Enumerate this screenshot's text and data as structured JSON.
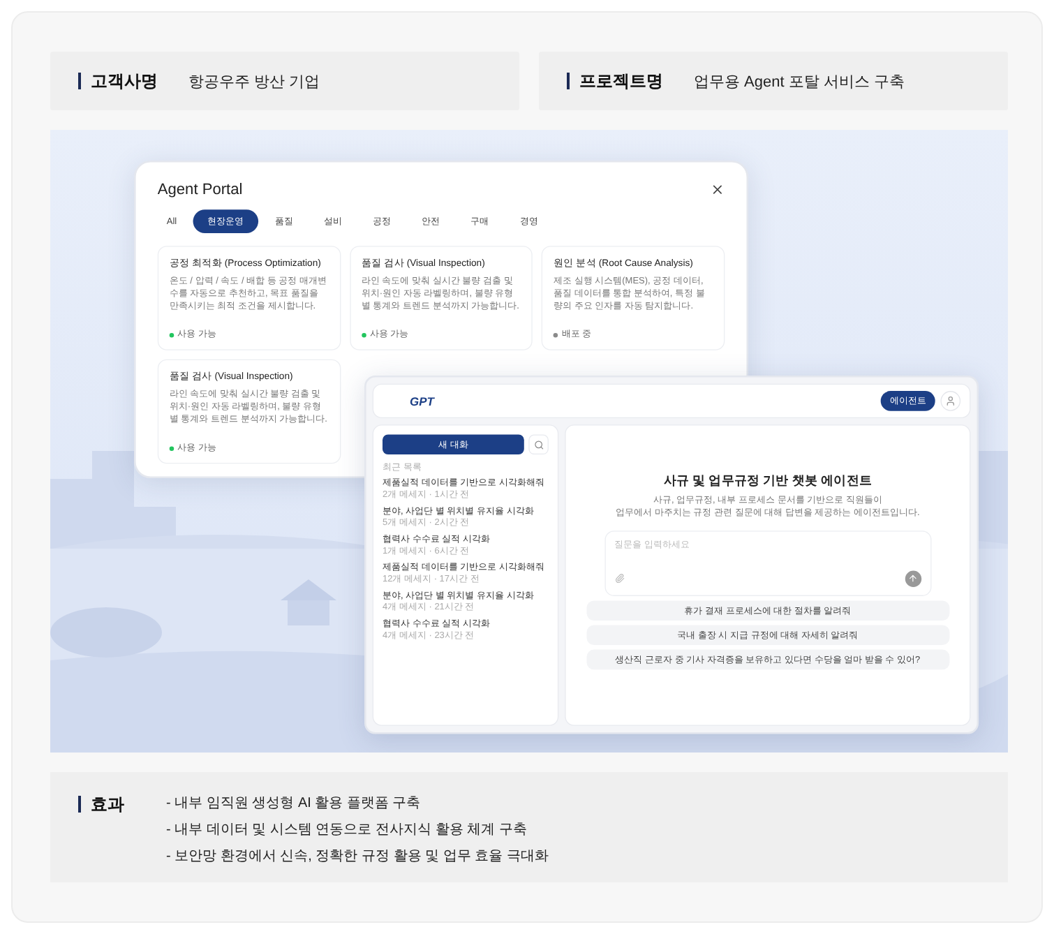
{
  "client": {
    "label": "고객사명",
    "value": "항공우주 방산 기업"
  },
  "project": {
    "label": "프로젝트명",
    "value": "업무용 Agent 포탈 서비스 구축"
  },
  "portal": {
    "title": "Agent Portal",
    "tabs": [
      {
        "label": "All",
        "selected": false
      },
      {
        "label": "현장운영",
        "selected": true
      },
      {
        "label": "품질",
        "selected": false
      },
      {
        "label": "설비",
        "selected": false
      },
      {
        "label": "공정",
        "selected": false
      },
      {
        "label": "안전",
        "selected": false
      },
      {
        "label": "구매",
        "selected": false
      },
      {
        "label": "경영",
        "selected": false
      }
    ],
    "cards": [
      {
        "title": "공정 최적화 (Process Optimization)",
        "body": "온도 / 압력 / 속도 / 배합 등 공정 매개변수를 자동으로 추천하고, 목표 품질을 만족시키는 최적 조건을 제시합니다.",
        "status": "사용 가능",
        "available": true
      },
      {
        "title": "품질 검사 (Visual Inspection)",
        "body": "라인 속도에 맞춰 실시간 불량 검출 및 위치·원인 자동 라벨링하며, 불량 유형 별 통계와 트렌드 분석까지 가능합니다.",
        "status": "사용 가능",
        "available": true
      },
      {
        "title": "원인 분석 (Root Cause Analysis)",
        "body": "제조 실행 시스템(MES), 공정 데이터, 품질 데이터를 통합 분석하여, 특정 불량의 주요 인자를 자동 탐지합니다.",
        "status": "배포 중",
        "available": false
      },
      {
        "title": "품질 검사 (Visual Inspection)",
        "body": "라인 속도에 맞춰 실시간 불량 검출 및 위치·원인 자동 라벨링하며, 불량 유형 별 통계와 트렌드 분석까지 가능합니다.",
        "status": "사용 가능",
        "available": true
      }
    ]
  },
  "gpt": {
    "logo": "GPT",
    "agent_button": "에이전트",
    "new_chat": "새 대화",
    "recent_label": "최근 목록",
    "chats": [
      {
        "title": "제품실적 데이터를 기반으로 시각화해줘",
        "meta": "2개 메세지 · 1시간 전"
      },
      {
        "title": "분야, 사업단 별 위치별 유지율 시각화",
        "meta": "5개 메세지 · 2시간 전"
      },
      {
        "title": "협력사 수수료 실적 시각화",
        "meta": "1개 메세지 · 6시간 전"
      },
      {
        "title": "제품실적 데이터를 기반으로 시각화해줘",
        "meta": "12개 메세지 · 17시간 전"
      },
      {
        "title": "분야, 사업단 별 위치별 유지율 시각화",
        "meta": "4개 메세지 · 21시간 전"
      },
      {
        "title": "협력사 수수료 실적 시각화",
        "meta": "4개 메세지 · 23시간 전"
      }
    ],
    "heading": "사규 및 업무규정 기반 챗봇 에이전트",
    "description": [
      "사규, 업무규정, 내부 프로세스 문서를 기반으로 직원들이",
      "업무에서 마주치는 규정 관련 질문에 대해 답변을 제공하는 에이전트입니다."
    ],
    "placeholder": "질문을 입력하세요",
    "suggestions": [
      "휴가 결재 프로세스에 대한 절차를 알려줘",
      "국내 출장 시 지급 규정에 대해 자세히 알려줘",
      "생산직 근로자 중 기사 자격증을 보유하고 있다면 수당을 얼마 받을 수 있어?"
    ]
  },
  "effects": {
    "label": "효과",
    "items": [
      "- 내부 임직원 생성형 AI 활용 플랫폼 구축",
      "- 내부 데이터 및 시스템 연동으로 전사지식 활용 체계 구축",
      "- 보안망 환경에서 신속, 정확한 규정 활용 및 업무 효율 극대화"
    ]
  }
}
